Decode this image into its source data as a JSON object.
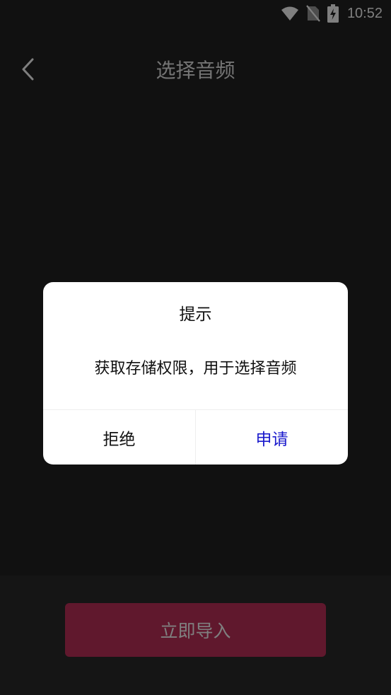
{
  "status_bar": {
    "time": "10:52",
    "icons": [
      "wifi-icon",
      "no-sim-icon",
      "battery-charging-icon"
    ]
  },
  "header": {
    "back_icon": "chevron-left-icon",
    "title": "选择音频"
  },
  "bottom_bar": {
    "import_label": "立即导入",
    "import_color": "#c1305a"
  },
  "dialog": {
    "title": "提示",
    "message": "获取存储权限，用于选择音频",
    "reject_label": "拒绝",
    "apply_label": "申请",
    "apply_color": "#1a1acc"
  }
}
